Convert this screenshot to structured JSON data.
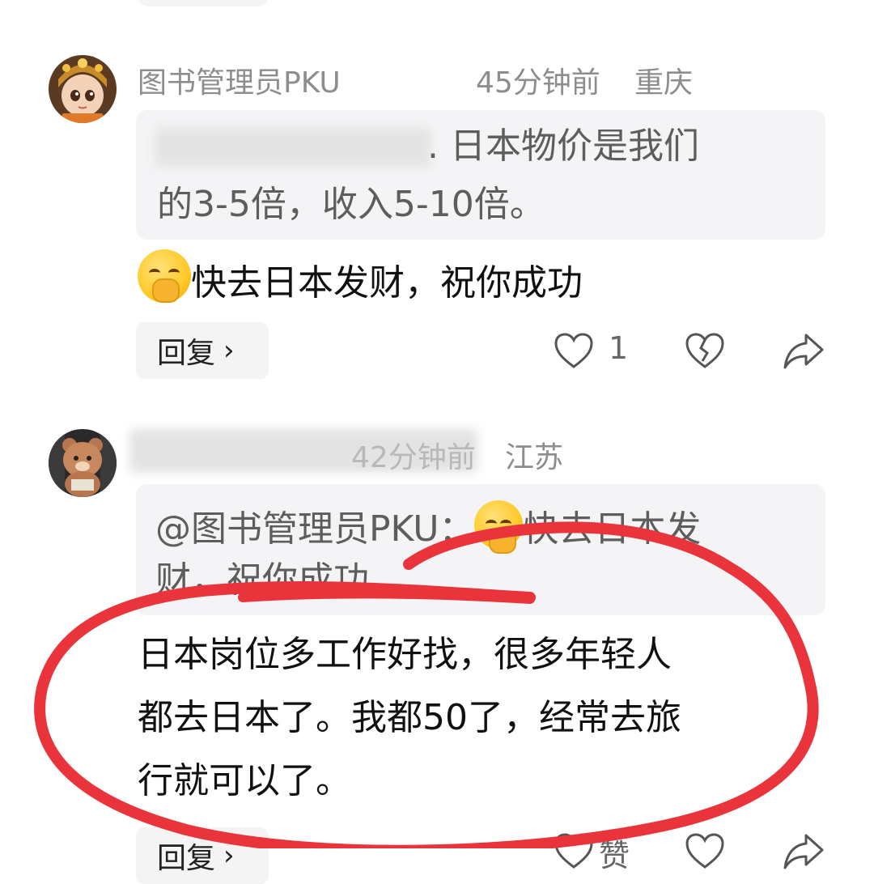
{
  "comments": [
    {
      "username": "图书管理员PKU",
      "time": "45分钟前",
      "location": "重庆",
      "quote_visible": ". 日本物价是我们",
      "quote_line2": "的3-5倍，收入5-10倍。",
      "text": "快去日本发财，祝你成功",
      "reply_label": "回复",
      "like_count": "1",
      "avatar_icon": "girl-avatar-icon"
    },
    {
      "username_visible": "",
      "time": "42分钟前",
      "location": "江苏",
      "quote_prefix": "@图书管理员PKU：",
      "quote_rest": "快去日本发",
      "quote_line2": "财，祝你成功",
      "text_line1": "日本岗位多工作好找，很多年轻人",
      "text_line2": "都去日本了。我都50了，经常去旅",
      "text_line3": "行就可以了。",
      "reply_label": "回复",
      "like_label": "赞",
      "avatar_icon": "bear-avatar-icon"
    }
  ],
  "colors": {
    "annotation": "#e8343a",
    "meta": "#8d8d8d",
    "quote_bg": "#f4f4f6"
  }
}
